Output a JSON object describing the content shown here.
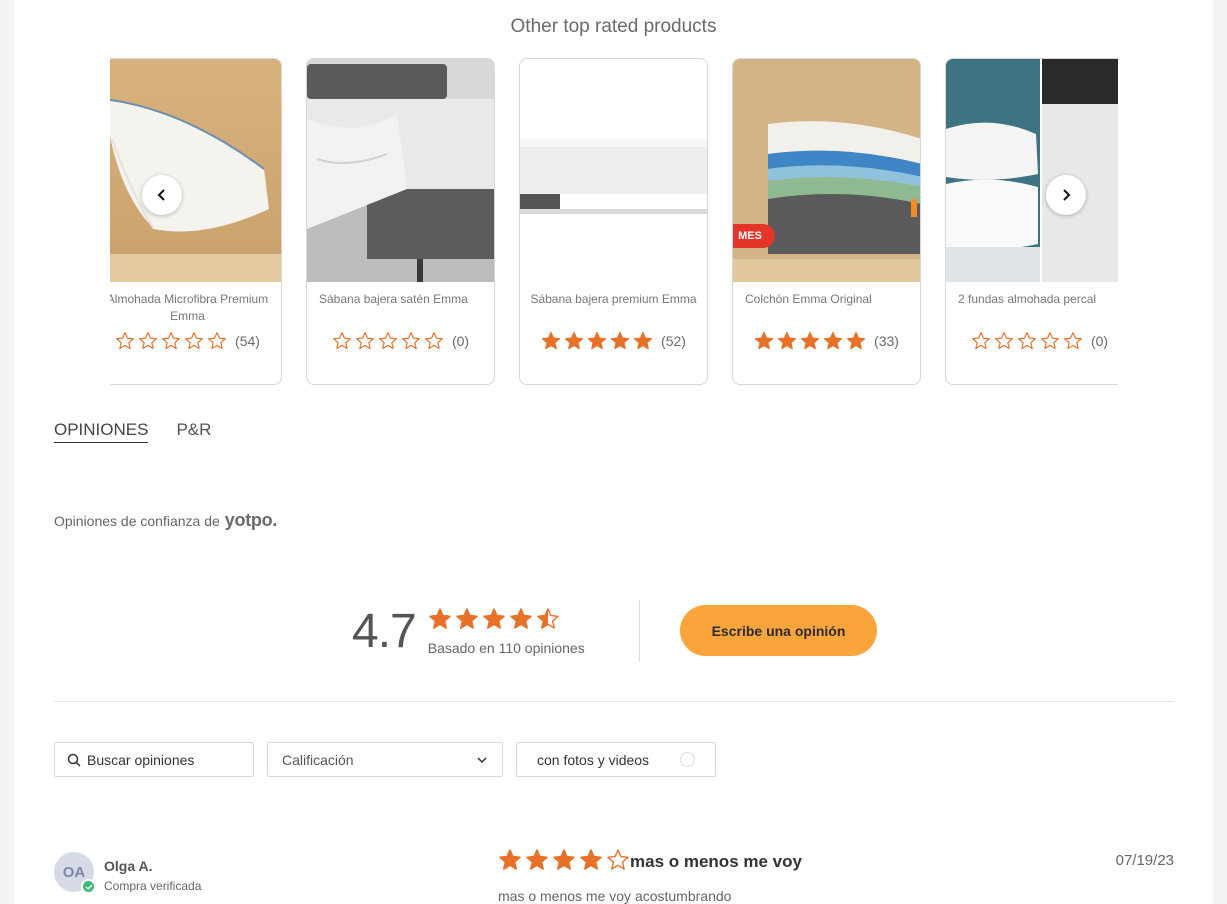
{
  "carousel": {
    "title": "Other top rated products",
    "products": [
      {
        "name": "Almohada Microfibra Premium Emma",
        "rating": 0,
        "count": "(54)"
      },
      {
        "name": "Sábana bajera satén Emma",
        "rating": 0,
        "count": "(0)"
      },
      {
        "name": "Sábana bajera premium Emma",
        "rating": 5,
        "count": "(52)"
      },
      {
        "name": "Colchón Emma Original",
        "rating": 5,
        "count": "(33)",
        "badge": "MES"
      },
      {
        "name": "2 fundas almohada percal",
        "rating": 0,
        "count": "(0)"
      }
    ]
  },
  "tabs": {
    "reviews": "OPINIONES",
    "qa": "P&R"
  },
  "trust": {
    "text": "Opiniones de confianza de",
    "logo": "yotpo."
  },
  "summary": {
    "average": "4.7",
    "based_on": "Basado en 110 opiniones",
    "stars": 4.5
  },
  "write_button": "Escribe una opinión",
  "filters": {
    "search_placeholder": "Buscar opiniones",
    "rating_label": "Calificación",
    "media_label": "con fotos y videos"
  },
  "review": {
    "initials": "OA",
    "author": "Olga A.",
    "verified": "Compra verificada",
    "stars": 4,
    "title": "mas o menos me voy",
    "date": "07/19/23",
    "body": "mas o menos me voy acostumbrando"
  },
  "colors": {
    "star": "#e8712a",
    "button": "#f9a53b",
    "verified": "#3cb878"
  }
}
